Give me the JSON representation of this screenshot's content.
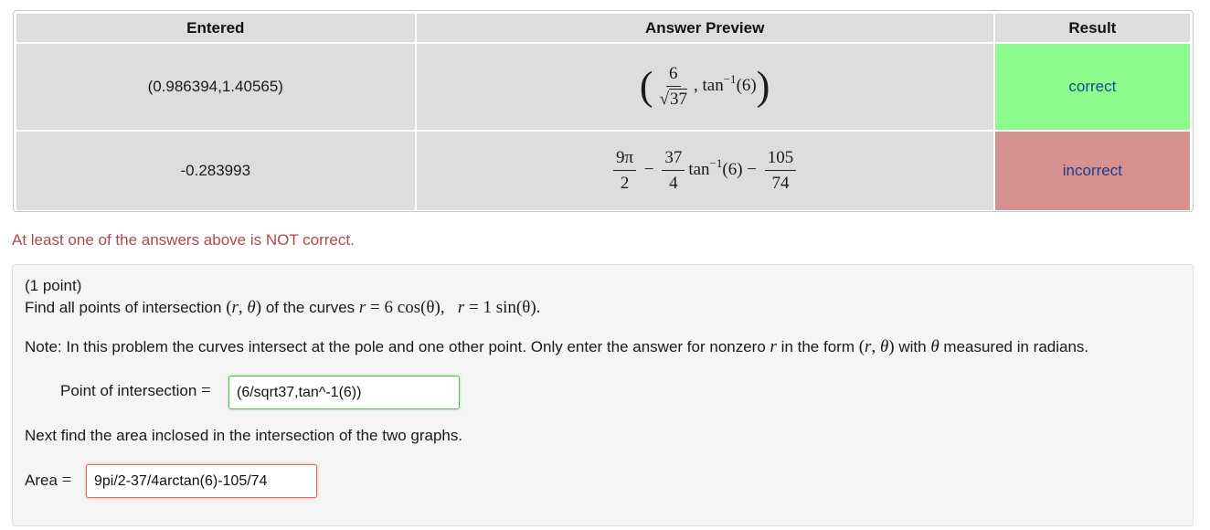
{
  "results_table": {
    "headers": [
      "Entered",
      "Answer Preview",
      "Result"
    ],
    "rows": [
      {
        "entered": "(0.986394,1.40565)",
        "preview": {
          "frac_num": "6",
          "sqrt_arg": "37",
          "func": "tan",
          "exp": "−1",
          "arg": "(6)"
        },
        "result": "correct"
      },
      {
        "entered": "-0.283993",
        "preview": {
          "t1_num": "9π",
          "t1_den": "2",
          "t2_num": "37",
          "t2_den": "4",
          "func": "tan",
          "exp": "−1",
          "arg": "(6)",
          "t3_num": "105",
          "t3_den": "74"
        },
        "result": "incorrect"
      }
    ]
  },
  "status_message": "At least one of the answers above is NOT correct.",
  "problem": {
    "points": "(1 point)",
    "statement_prefix": "Find all points of intersection",
    "statement_mid": "of the curves",
    "curve1": "6 cos(θ),",
    "curve2": "1 sin(θ).",
    "note_prefix": "Note: In this problem the curves intersect at the pole and one other point. Only enter the answer for nonzero",
    "note_mid": "in the form",
    "note_suffix": "measured in radians.",
    "note_with": "with",
    "point_label": "Point of intersection",
    "point_value": "(6/sqrt37,tan^-1(6))",
    "area_prompt": "Next find the area inclosed in the intersection of the two graphs.",
    "area_label": "Area",
    "area_value": "9pi/2-37/4arctan(6)-105/74"
  },
  "colors": {
    "correct_bg": "#8dfb8d",
    "incorrect_bg": "#d79090",
    "status_text": "#b0474a"
  }
}
